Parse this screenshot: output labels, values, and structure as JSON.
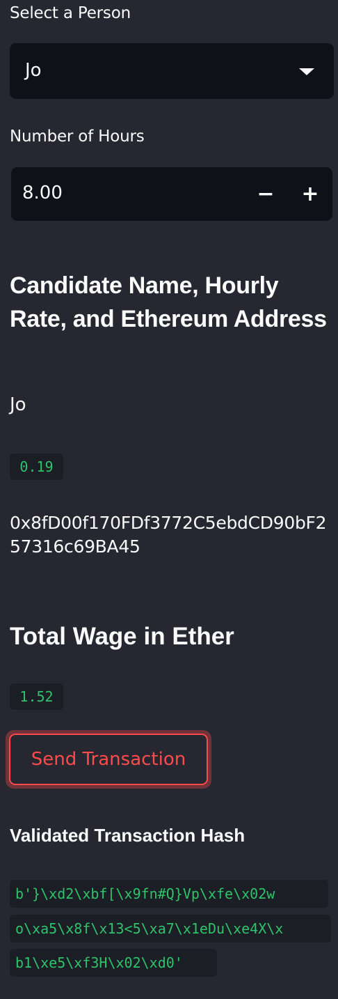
{
  "person_select": {
    "label": "Select a Person",
    "value": "Jo"
  },
  "hours_input": {
    "label": "Number of Hours",
    "value": "8.00",
    "minus": "−",
    "plus": "+"
  },
  "candidate": {
    "heading": "Candidate Name, Hourly Rate, and Ethereum Address",
    "name": "Jo",
    "rate": "0.19",
    "address": "0x8fD00f170FDf3772C5ebdCD90bF257316c69BA45"
  },
  "wage": {
    "heading": "Total Wage in Ether",
    "value": "1.52"
  },
  "send_button": {
    "label": "Send Transaction"
  },
  "transaction": {
    "heading": "Validated Transaction Hash",
    "hash_lines": [
      "b'}\\xd2\\xbf[\\x9fn#Q}Vp\\xfe\\x02w",
      "o\\xa5\\x8f\\x13<5\\xa7\\x1eDu\\xe4X\\x",
      "b1\\xe5\\xf3H\\x02\\xd0'"
    ]
  },
  "colors": {
    "background": "#262730",
    "input_background": "#0e1117",
    "accent": "#ff4b4b",
    "code_green": "#2ec36b"
  }
}
